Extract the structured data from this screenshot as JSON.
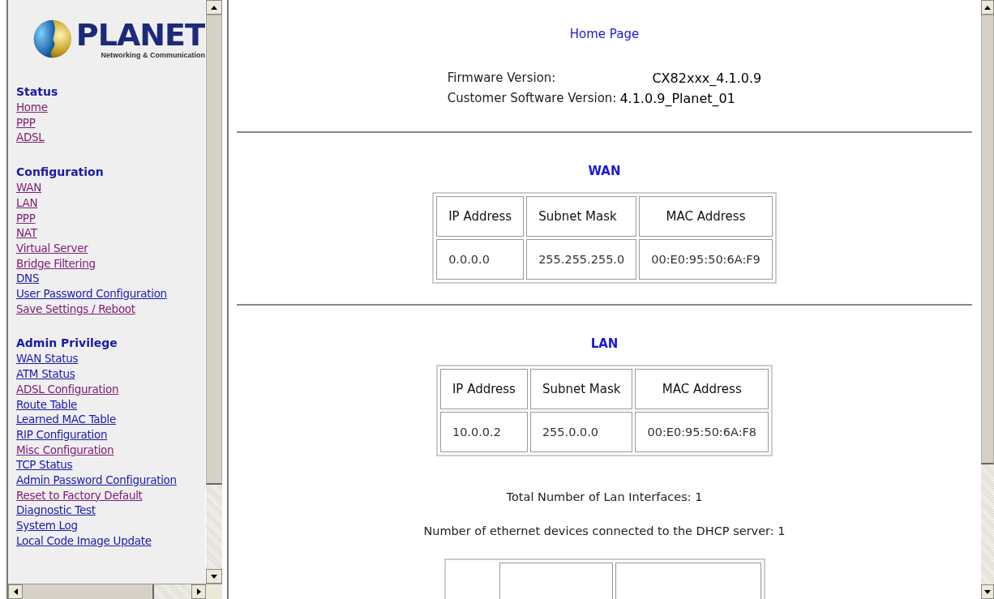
{
  "logo": {
    "name": "PLANET",
    "tagline": "Networking & Communication"
  },
  "sidebar": {
    "sections": [
      {
        "heading": "Status",
        "links": [
          {
            "label": "Home",
            "visited": true
          },
          {
            "label": "PPP",
            "visited": true
          },
          {
            "label": "ADSL",
            "visited": true
          }
        ]
      },
      {
        "heading": "Configuration",
        "links": [
          {
            "label": "WAN",
            "visited": true
          },
          {
            "label": "LAN",
            "visited": true
          },
          {
            "label": "PPP",
            "visited": true
          },
          {
            "label": "NAT",
            "visited": true
          },
          {
            "label": "Virtual Server",
            "visited": true
          },
          {
            "label": "Bridge Filtering",
            "visited": true
          },
          {
            "label": "DNS",
            "visited": false
          },
          {
            "label": "User Password Configuration",
            "visited": false
          },
          {
            "label": "Save Settings / Reboot",
            "visited": true
          }
        ]
      },
      {
        "heading": "Admin Privilege",
        "links": [
          {
            "label": "WAN Status",
            "visited": false
          },
          {
            "label": "ATM Status",
            "visited": false
          },
          {
            "label": "ADSL Configuration",
            "visited": true
          },
          {
            "label": "Route Table",
            "visited": false
          },
          {
            "label": "Learned MAC Table",
            "visited": false
          },
          {
            "label": "RIP Configuration",
            "visited": false
          },
          {
            "label": "Misc Configuration",
            "visited": true
          },
          {
            "label": "TCP Status",
            "visited": false
          },
          {
            "label": "Admin Password Configuration",
            "visited": false
          },
          {
            "label": "Reset to Factory Default",
            "visited": true
          },
          {
            "label": "Diagnostic Test",
            "visited": false
          },
          {
            "label": "System Log",
            "visited": false
          },
          {
            "label": "Local Code Image Update",
            "visited": false
          }
        ]
      }
    ]
  },
  "main": {
    "title": "Home Page",
    "versions": [
      {
        "label": "Firmware Version:",
        "value": "CX82xxx_4.1.0.9"
      },
      {
        "label": "Customer Software Version:",
        "value": "4.1.0.9_Planet_01"
      }
    ],
    "wan": {
      "title": "WAN",
      "columns": [
        "IP Address",
        "Subnet Mask",
        "MAC Address"
      ],
      "rows": [
        [
          "0.0.0.0",
          "255.255.255.0",
          "00:E0:95:50:6A:F9"
        ]
      ]
    },
    "lan": {
      "title": "LAN",
      "columns": [
        "IP Address",
        "Subnet Mask",
        "MAC Address"
      ],
      "rows": [
        [
          "10.0.0.2",
          "255.0.0.0",
          "00:E0:95:50:6A:F8"
        ]
      ],
      "notes": [
        "Total Number of Lan Interfaces: 1",
        "Number of ethernet devices connected to the DHCP server: 1"
      ]
    }
  }
}
